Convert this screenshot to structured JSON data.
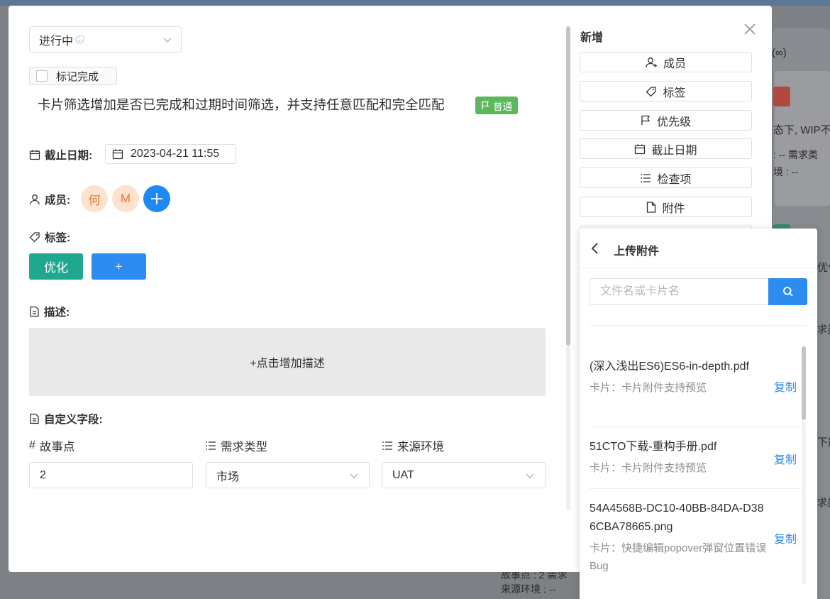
{
  "background": {
    "snippets": [
      "(∞)",
      "态下, WIP不",
      ": --   需求类",
      "境 : --",
      "优化",
      "求类",
      "下能",
      "求类",
      "故事点 : 2   需求",
      "来源环境 : --"
    ]
  },
  "modal": {
    "status": {
      "value": "进行中",
      "emoji": "🌧"
    },
    "mark_done_label": "标记完成",
    "title": "卡片筛选增加是否已完成和过期时间筛选，并支持任意匹配和完全匹配",
    "priority_badge": "普通",
    "due_date": {
      "label": "截止日期:",
      "value": "2023-04-21 11:55"
    },
    "members": {
      "label": "成员:",
      "avatars": [
        "何",
        "M"
      ],
      "add_symbol": "+"
    },
    "tags": {
      "label": "标签:",
      "items": [
        "优化"
      ],
      "add_symbol": "+"
    },
    "description": {
      "label": "描述:",
      "placeholder": "+点击增加描述"
    },
    "custom_fields": {
      "label": "自定义字段:",
      "fields": [
        {
          "label": "故事点",
          "value": "2",
          "icon": "hash-icon"
        },
        {
          "label": "需求类型",
          "value": "市场",
          "icon": "list-icon"
        },
        {
          "label": "来源环境",
          "value": "UAT",
          "icon": "list-icon"
        }
      ]
    }
  },
  "add_panel": {
    "heading": "新增",
    "buttons": [
      {
        "label": "成员",
        "icon": "user-add-icon"
      },
      {
        "label": "标签",
        "icon": "tag-icon"
      },
      {
        "label": "优先级",
        "icon": "flag-icon"
      },
      {
        "label": "截止日期",
        "icon": "calendar-icon"
      },
      {
        "label": "检查项",
        "icon": "checklist-icon"
      },
      {
        "label": "附件",
        "icon": "file-icon"
      }
    ]
  },
  "upload_popover": {
    "title": "上传附件",
    "search_placeholder": "文件名或卡片名",
    "files": [
      {
        "name": "(深入浅出ES6)ES6-in-depth.pdf",
        "card": "卡片：卡片附件支持预览",
        "copy": "复制"
      },
      {
        "name": "51CTO下载-重构手册.pdf",
        "card": "卡片：卡片附件支持预览",
        "copy": "复制"
      },
      {
        "name": "54A4568B-DC10-40BB-84DA-D386CBA78665.png",
        "card": "卡片：快捷编辑popover弹窗位置错误Bug",
        "copy": "复制"
      }
    ]
  },
  "colors": {
    "primary": "#2d8cf0",
    "tag_green": "#1ea88f",
    "priority_green": "#5cb85c",
    "avatar_soft": "#fde3cf"
  }
}
